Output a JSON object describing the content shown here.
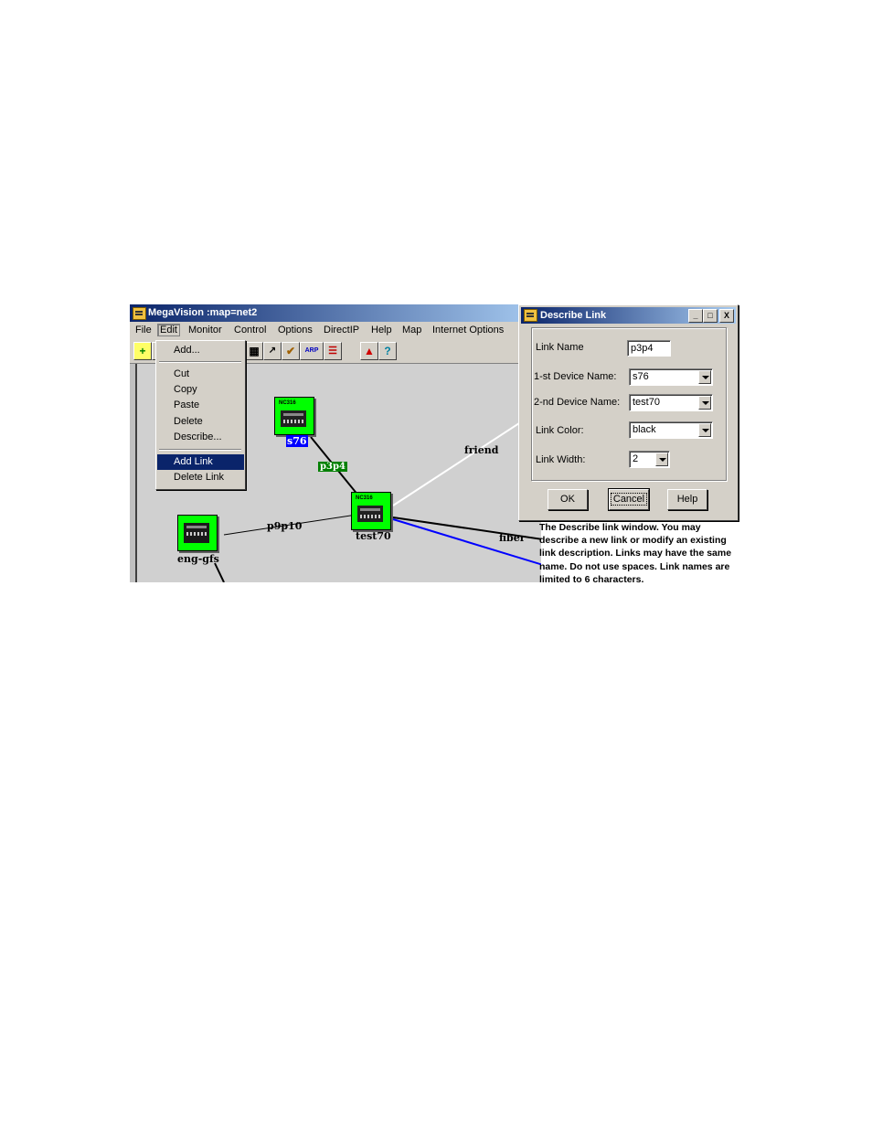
{
  "app": {
    "title": "MegaVision :map=net2",
    "menu": [
      "File",
      "Edit",
      "Monitor",
      "Control",
      "Options",
      "DirectIP",
      "Help",
      "Map",
      "Internet Options"
    ],
    "edit_menu": {
      "items": [
        "Add...",
        "Cut",
        "Copy",
        "Paste",
        "Delete",
        "Describe...",
        "Add Link",
        "Delete Link"
      ],
      "selected": "Add Link"
    },
    "toolbar": {
      "icons": [
        "add-icon",
        "network-icon",
        "graph-icon",
        "tools-icon",
        "arp-icon",
        "list-icon",
        "alarm-icon",
        "help-icon"
      ],
      "arp_label": "ARP",
      "help_glyph": "?"
    }
  },
  "map": {
    "devices": [
      {
        "name": "s76",
        "model": "NC316"
      },
      {
        "name": "test70",
        "model": "NC316"
      },
      {
        "name": "eng-gfs",
        "model": ""
      }
    ],
    "links": [
      "p3p4",
      "p9p10",
      "friend",
      "fiber"
    ],
    "colors": {
      "device": "#00ff00",
      "selected_label": "#0000ff",
      "link_green": "#008000",
      "blue_link": "#0000ff",
      "white_link": "#ffffff"
    }
  },
  "dialog": {
    "title": "Describe Link",
    "controls": {
      "minimize": "_",
      "maximize": "□",
      "close": "X"
    },
    "fields": {
      "link_name": {
        "label": "Link Name",
        "value": "p3p4"
      },
      "device1": {
        "label": "1-st Device Name:",
        "value": "s76"
      },
      "device2": {
        "label": "2-nd Device Name:",
        "value": "test70"
      },
      "color": {
        "label": "Link Color:",
        "value": "black"
      },
      "width": {
        "label": "Link Width:",
        "value": "2"
      }
    },
    "buttons": {
      "ok": "OK",
      "cancel": "Cancel",
      "help": "Help"
    }
  },
  "caption": "The Describe link window. You may describe a new link or modify an existing link description. Links may have the same name. Do not use spaces. Link names are limited to 6 characters."
}
